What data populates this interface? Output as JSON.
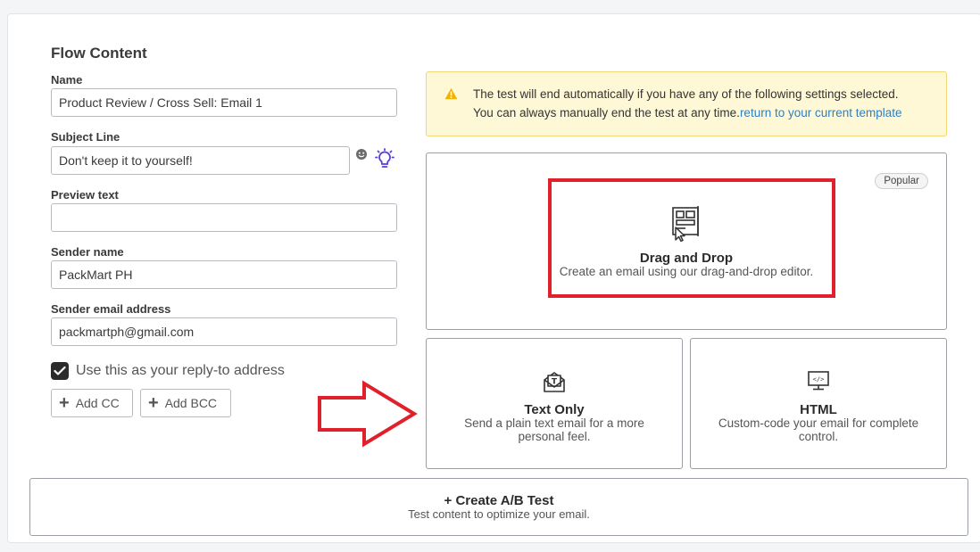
{
  "form": {
    "section_title": "Flow Content",
    "name_label": "Name",
    "name_value": "Product Review / Cross Sell: Email 1",
    "subject_label": "Subject Line",
    "subject_value": "Don't keep it to yourself!",
    "preview_label": "Preview text",
    "preview_value": "",
    "sender_name_label": "Sender name",
    "sender_name_value": "PackMart PH",
    "sender_email_label": "Sender email address",
    "sender_email_value": "packmartph@gmail.com",
    "reply_to_label": "Use this as your reply-to address",
    "reply_to_checked": true,
    "add_cc_label": "Add CC",
    "add_bcc_label": "Add BCC"
  },
  "alert": {
    "line1": "The test will end automatically if you have any of the following settings selected.",
    "line2": "You can always manually end the test at any time.",
    "link": "return to your current template"
  },
  "templates": {
    "dnd": {
      "badge": "Popular",
      "title": "Drag and Drop",
      "desc": "Create an email using our drag-and-drop editor."
    },
    "text": {
      "title": "Text Only",
      "desc": "Send a plain text email for a more personal feel."
    },
    "html": {
      "title": "HTML",
      "desc": "Custom-code your email for complete control."
    }
  },
  "ab_test": {
    "title": "+ Create A/B Test",
    "desc": "Test content to optimize your email."
  },
  "colors": {
    "annotation_red": "#e0202a",
    "alert_bg": "#fff8d6",
    "link_blue": "#2f7fc1",
    "bulb_purple": "#5b3fd1"
  }
}
